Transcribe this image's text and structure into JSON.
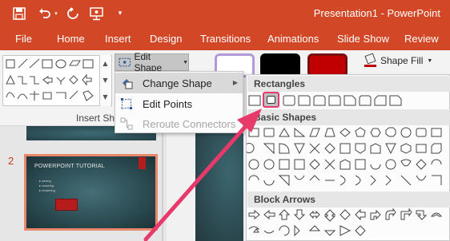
{
  "titlebar": {
    "title": "Presentation1  -  PowerPoint",
    "save_icon": "save-icon",
    "undo_icon": "undo-icon",
    "redo_icon": "redo-icon",
    "present_icon": "present-from-beginning-icon",
    "customize_icon": "customize-quick-access-icon"
  },
  "tabs": [
    "File",
    "Home",
    "Insert",
    "Design",
    "Transitions",
    "Animations",
    "Slide Show",
    "Review"
  ],
  "ribbon": {
    "edit_shape_label": "Edit Shape",
    "insert_shapes_group": "Insert Shapes",
    "shape_fill_label": "Shape Fill",
    "style_colors": [
      "#ffffff",
      "#000000",
      "#c00000"
    ]
  },
  "menu": {
    "change_shape": "Change Shape",
    "edit_points": "Edit Points",
    "reroute_connectors": "Reroute Connectors"
  },
  "submenu": {
    "rectangles": "Rectangles",
    "basic_shapes": "Basic Shapes",
    "block_arrows": "Block Arrows"
  },
  "slides": {
    "current_number": "2",
    "thumb_title": "POWERPOINT TUTORIAL",
    "thumb_bullets": [
      "saving",
      "resaving",
      "renaming"
    ]
  },
  "colors": {
    "accent": "#d24726",
    "highlight": "#e8396b"
  }
}
